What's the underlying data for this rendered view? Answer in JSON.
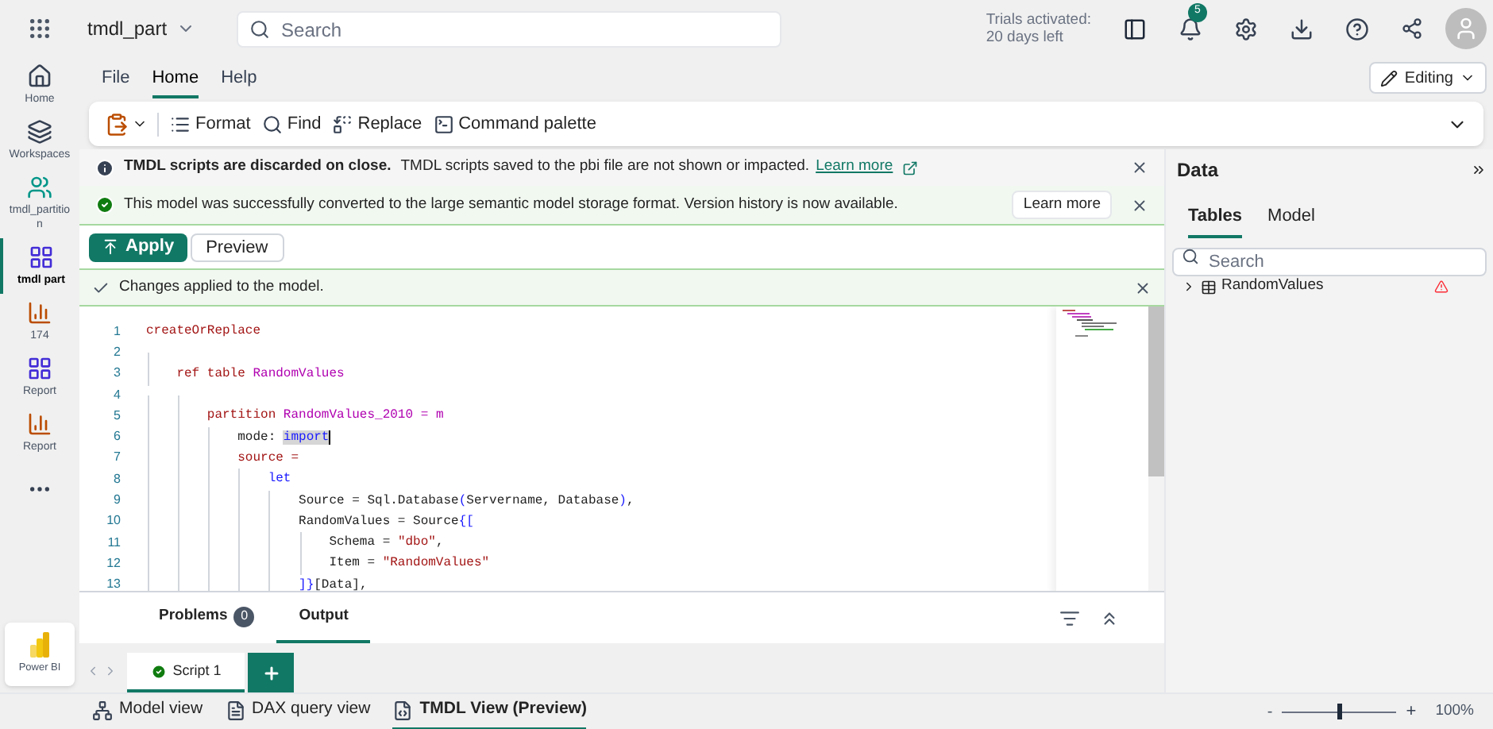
{
  "top_bar": {
    "workspace": "tmdl_part",
    "search": {
      "placeholder": "Search"
    },
    "trial": [
      "Trials activated:",
      "20 days left"
    ],
    "notification_count": "5"
  },
  "left_nav": {
    "items": [
      {
        "label": "Home",
        "kind": "home",
        "selected": false
      },
      {
        "label": "Workspaces",
        "kind": "workspaces",
        "selected": false
      },
      {
        "label": "tmdl_partition",
        "kind": "model",
        "selected": false
      },
      {
        "label": "tmdl part",
        "kind": "grid",
        "selected": true
      },
      {
        "label": "174",
        "kind": "chart",
        "selected": false
      },
      {
        "label": "Report",
        "kind": "grid",
        "selected": false
      },
      {
        "label": "Report",
        "kind": "chart",
        "selected": false
      }
    ],
    "app": "Power BI"
  },
  "menu_tabs": [
    {
      "label": "File",
      "selected": false
    },
    {
      "label": "Home",
      "selected": true
    },
    {
      "label": "Help",
      "selected": false
    }
  ],
  "mode_button": "Editing",
  "toolbar": [
    {
      "label": "Format",
      "kind": "format"
    },
    {
      "label": "Find",
      "kind": "find"
    },
    {
      "label": "Replace",
      "kind": "replace"
    },
    {
      "label": "Command palette",
      "kind": "palette"
    }
  ],
  "info_banner": {
    "title": "TMDL scripts are discarded on close.",
    "text": "TMDL scripts saved to the pbi file are not shown or impacted.",
    "link": "Learn more"
  },
  "success_banner": {
    "text": "This model was successfully converted to the large semantic model storage format. Version history is now available.",
    "button": "Learn more"
  },
  "actions": {
    "apply": "Apply",
    "preview": "Preview"
  },
  "applied_banner": {
    "text": "Changes applied to the model."
  },
  "code_lines": [
    {
      "number": "1",
      "tokens": [
        {
          "text": "createOrReplace",
          "kind": "keyword"
        }
      ]
    },
    {
      "number": "2"
    },
    {
      "number": "3",
      "tokens": [
        {
          "text": "    ref table ",
          "kind": "keyword"
        },
        {
          "text": "RandomValues",
          "kind": "name"
        }
      ]
    },
    {
      "number": "4"
    },
    {
      "number": "5",
      "tokens": [
        {
          "text": "        partition ",
          "kind": "keyword"
        },
        {
          "text": "RandomValues_2010 = m",
          "kind": "name"
        }
      ]
    },
    {
      "number": "6",
      "tokens": [
        {
          "text": "            mode: ",
          "kind": "plain"
        },
        {
          "text": "import",
          "kind": "selected"
        }
      ]
    },
    {
      "number": "7",
      "tokens": [
        {
          "text": "            source =",
          "kind": "keyword"
        }
      ]
    },
    {
      "number": "8",
      "tokens": [
        {
          "text": "                let",
          "kind": "blue"
        }
      ]
    },
    {
      "number": "9",
      "tokens": [
        {
          "text": "                    Source = Sql.Database",
          "kind": "plain"
        },
        {
          "text": "(",
          "kind": "blue"
        },
        {
          "text": "Servername, Database",
          "kind": "plain"
        },
        {
          "text": ")",
          "kind": "blue"
        },
        {
          "text": ",",
          "kind": "plain"
        }
      ]
    },
    {
      "number": "10",
      "tokens": [
        {
          "text": "                    RandomValues = Source",
          "kind": "plain"
        },
        {
          "text": "{[",
          "kind": "blue"
        }
      ]
    },
    {
      "number": "11",
      "tokens": [
        {
          "text": "                        Schema = ",
          "kind": "plain"
        },
        {
          "text": "\"dbo\"",
          "kind": "string"
        },
        {
          "text": ",",
          "kind": "plain"
        }
      ]
    },
    {
      "number": "12",
      "tokens": [
        {
          "text": "                        Item = ",
          "kind": "plain"
        },
        {
          "text": "\"RandomValues\"",
          "kind": "string"
        }
      ]
    },
    {
      "number": "13",
      "tokens": [
        {
          "text": "                    ]}",
          "kind": "blue"
        },
        {
          "text": "[Data]",
          "kind": "plain"
        },
        {
          "text": ",",
          "kind": "plain"
        }
      ]
    }
  ],
  "output_tabs": [
    {
      "label": "Problems",
      "count": "0",
      "selected": false
    },
    {
      "label": "Output",
      "selected": true
    }
  ],
  "script_tabs": [
    {
      "label": "Script 1",
      "selected": true
    }
  ],
  "view_tabs": [
    {
      "label": "Model view",
      "kind": "model",
      "selected": false
    },
    {
      "label": "DAX query view",
      "kind": "dax",
      "selected": false
    },
    {
      "label": "TMDL View (Preview)",
      "kind": "tmdl",
      "selected": true
    }
  ],
  "zoom": {
    "minus": "-",
    "plus": "+",
    "level": 0.5,
    "reading": "100%"
  },
  "data_panel": {
    "title": "Data",
    "tabs": [
      {
        "label": "Tables",
        "selected": true
      },
      {
        "label": "Model",
        "selected": false
      }
    ],
    "search": {
      "placeholder": "Search"
    },
    "items": [
      {
        "label": "RandomValues",
        "expanded": false,
        "warning": true
      }
    ]
  }
}
